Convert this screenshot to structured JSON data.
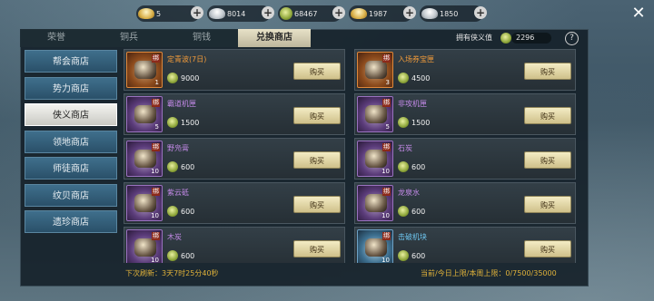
{
  "currencies": [
    {
      "icon": "gold-ingot-icon",
      "value": "5"
    },
    {
      "icon": "silver-ingot-icon",
      "value": "8014"
    },
    {
      "icon": "coin-icon",
      "value": "68467"
    },
    {
      "icon": "gold-ingot-icon",
      "value": "1987"
    },
    {
      "icon": "silver-ingot-icon",
      "value": "1850"
    }
  ],
  "tabs": [
    "荣誉",
    "铜兵",
    "铜钱",
    "兑换商店"
  ],
  "owned": {
    "label": "拥有侠义值",
    "value": "2296"
  },
  "sidebar": [
    "帮会商店",
    "势力商店",
    "侠义商店",
    "领地商店",
    "师徒商店",
    "纹贝商店",
    "遗珍商店"
  ],
  "active_sidebar": 2,
  "items": [
    {
      "name": "定青波(7日)",
      "price": "9000",
      "qty": "1",
      "rarity": "orange",
      "tag": "绑"
    },
    {
      "name": "入场券宝匣",
      "price": "4500",
      "qty": "3",
      "rarity": "orange",
      "tag": "绑"
    },
    {
      "name": "霸道机匣",
      "price": "1500",
      "qty": "5",
      "rarity": "purple",
      "tag": "绑"
    },
    {
      "name": "非攻机匣",
      "price": "1500",
      "qty": "5",
      "rarity": "purple",
      "tag": "绑"
    },
    {
      "name": "野凫膏",
      "price": "600",
      "qty": "10",
      "rarity": "purple",
      "tag": "绑"
    },
    {
      "name": "石炭",
      "price": "600",
      "qty": "10",
      "rarity": "purple",
      "tag": "绑"
    },
    {
      "name": "紫云砥",
      "price": "600",
      "qty": "10",
      "rarity": "purple",
      "tag": "绑"
    },
    {
      "name": "龙泉水",
      "price": "600",
      "qty": "10",
      "rarity": "purple",
      "tag": "绑"
    },
    {
      "name": "木炭",
      "price": "600",
      "qty": "10",
      "rarity": "purple",
      "tag": "绑"
    },
    {
      "name": "击破机块",
      "price": "600",
      "qty": "10",
      "rarity": "blue",
      "tag": "绑"
    }
  ],
  "buy_label": "购买",
  "footer": {
    "refresh": "下次刷新：3天7时25分40秒",
    "limit": "当前/今日上限/本周上限：0/7500/35000"
  }
}
